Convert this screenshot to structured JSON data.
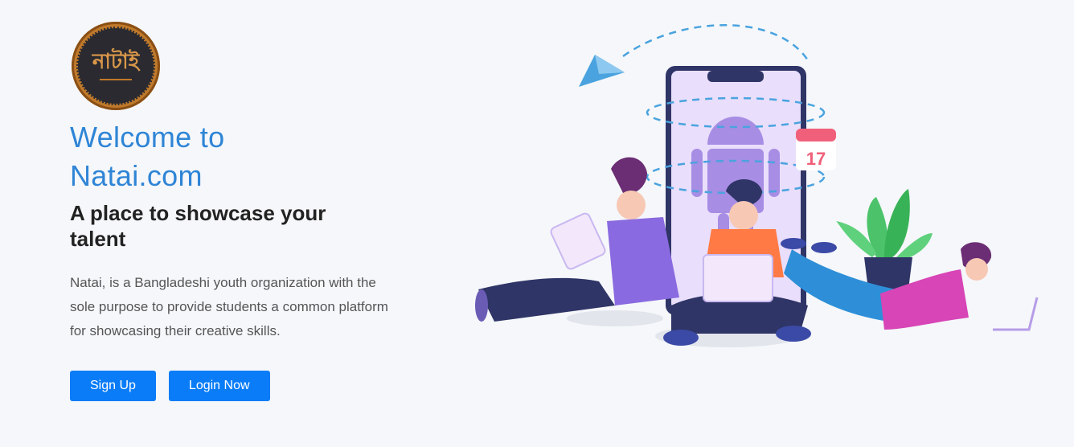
{
  "logo": {
    "text": "নাটাই"
  },
  "hero": {
    "title_line1": "Welcome to",
    "title_line2": "Natai.com",
    "subtitle": "A place to showcase your talent",
    "description": "Natai, is a Bangladeshi youth organization with the sole purpose to provide students a common platform for showcasing their creative skills.",
    "signup_label": "Sign Up",
    "login_label": "Login Now"
  },
  "illustration": {
    "calendar_day": "17"
  },
  "colors": {
    "accent": "#2f85d6",
    "button": "#0a7cf7",
    "background": "#f5f7fa"
  }
}
